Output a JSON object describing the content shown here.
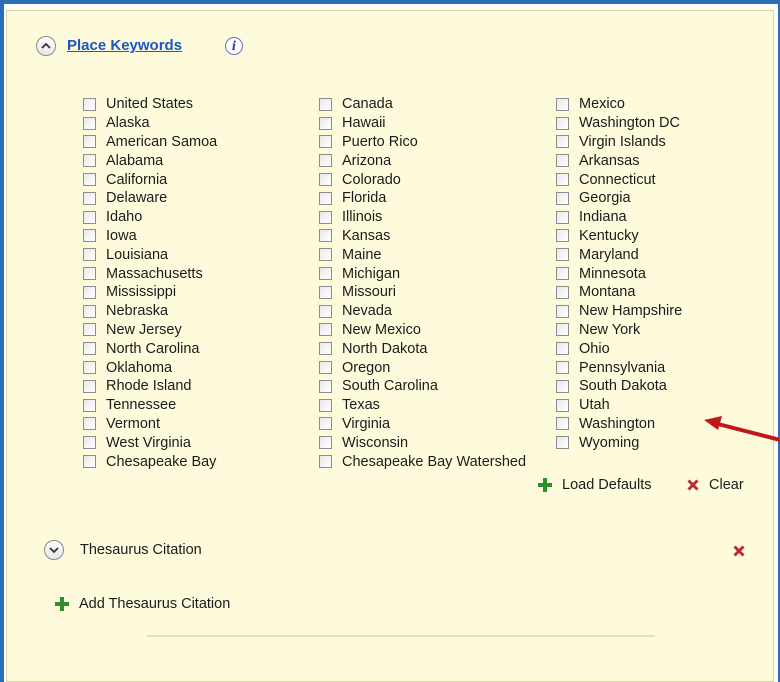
{
  "place_keywords": {
    "title": "Place Keywords",
    "info_icon": "i",
    "columns": [
      [
        "United States",
        "Alaska",
        "American Samoa",
        "Alabama",
        "California",
        "Delaware",
        "Idaho",
        "Iowa",
        "Louisiana",
        "Massachusetts",
        "Mississippi",
        "Nebraska",
        "New Jersey",
        "North Carolina",
        "Oklahoma",
        "Rhode Island",
        "Tennessee",
        "Vermont",
        "West Virginia",
        "Chesapeake Bay"
      ],
      [
        "Canada",
        "Hawaii",
        "Puerto Rico",
        "Arizona",
        "Colorado",
        "Florida",
        "Illinois",
        "Kansas",
        "Maine",
        "Michigan",
        "Missouri",
        "Nevada",
        "New Mexico",
        "North Dakota",
        "Oregon",
        "South Carolina",
        "Texas",
        "Virginia",
        "Wisconsin",
        "Chesapeake Bay Watershed"
      ],
      [
        "Mexico",
        "Washington DC",
        "Virgin Islands",
        "Arkansas",
        "Connecticut",
        "Georgia",
        "Indiana",
        "Kentucky",
        "Maryland",
        "Minnesota",
        "Montana",
        "New Hampshire",
        "New York",
        "Ohio",
        "Pennsylvania",
        "South Dakota",
        "Utah",
        "Washington",
        "Wyoming"
      ]
    ],
    "load_defaults_label": "Load Defaults",
    "clear_label": "Clear"
  },
  "thesaurus": {
    "title": "Thesaurus Citation",
    "add_label": "Add Thesaurus Citation"
  },
  "colors": {
    "panel_bg": "#fefbdc",
    "link": "#1a56c4",
    "add_green": "#2f8f2f",
    "remove_red": "#c0283a",
    "annotation_arrow": "#c01818",
    "frame_border": "#2a6fb5"
  },
  "icons": [
    "chevron-up-icon",
    "info-icon",
    "checkbox",
    "plus-icon",
    "x-icon",
    "chevron-down-icon",
    "annotation-arrow"
  ]
}
